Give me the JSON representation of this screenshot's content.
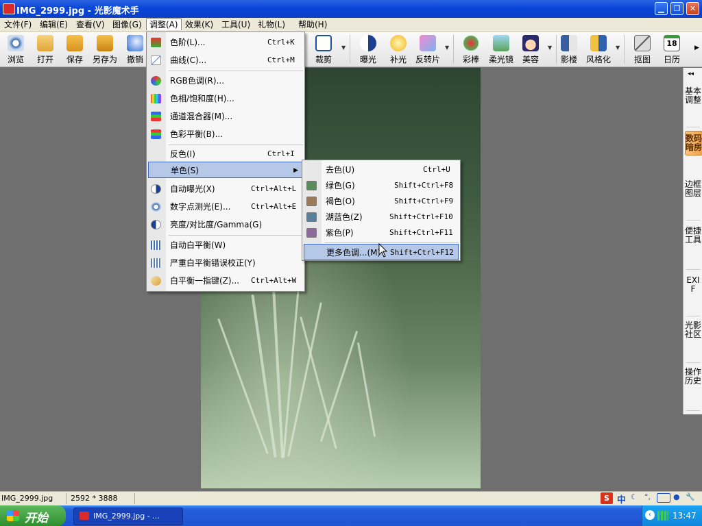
{
  "window": {
    "title": "IMG_2999.jpg - 光影魔术手",
    "minimize_icon": "minimize-icon",
    "maximize_icon": "restore-icon",
    "close_icon": "close-icon"
  },
  "menubar": {
    "items": [
      {
        "label": "文件(F)"
      },
      {
        "label": "编辑(E)"
      },
      {
        "label": "查看(V)"
      },
      {
        "label": "图像(G)"
      },
      {
        "label": "调整(A)"
      },
      {
        "label": "效果(K)"
      },
      {
        "label": "工具(U)"
      },
      {
        "label": "礼物(L)"
      },
      {
        "label": "帮助(H)"
      }
    ]
  },
  "toolbar": {
    "items": [
      {
        "label": "浏览"
      },
      {
        "label": "打开"
      },
      {
        "label": "保存"
      },
      {
        "label": "另存为"
      },
      {
        "label": "撤销"
      },
      {
        "label": "裁剪"
      },
      {
        "label": "曝光"
      },
      {
        "label": "补光"
      },
      {
        "label": "反转片"
      },
      {
        "label": "彩棒"
      },
      {
        "label": "柔光镜"
      },
      {
        "label": "美容"
      },
      {
        "label": "影楼"
      },
      {
        "label": "风格化"
      },
      {
        "label": "抠图"
      },
      {
        "label": "日历"
      }
    ],
    "calendar_day": "18"
  },
  "adjust_menu": {
    "items": [
      {
        "label": "色阶(L)...",
        "shortcut": "Ctrl+K"
      },
      {
        "label": "曲线(C)...",
        "shortcut": "Ctrl+M"
      },
      {
        "label": "RGB色调(R)...",
        "shortcut": ""
      },
      {
        "label": "色相/饱和度(H)...",
        "shortcut": ""
      },
      {
        "label": "通道混合器(M)...",
        "shortcut": ""
      },
      {
        "label": "色彩平衡(B)...",
        "shortcut": ""
      },
      {
        "label": "反色(I)",
        "shortcut": "Ctrl+I"
      },
      {
        "label": "单色(S)",
        "shortcut": ""
      },
      {
        "label": "自动曝光(X)",
        "shortcut": "Ctrl+Alt+L"
      },
      {
        "label": "数字点测光(E)...",
        "shortcut": "Ctrl+Alt+E"
      },
      {
        "label": "亮度/对比度/Gamma(G)",
        "shortcut": ""
      },
      {
        "label": "自动白平衡(W)",
        "shortcut": ""
      },
      {
        "label": "严重白平衡错误校正(Y)",
        "shortcut": ""
      },
      {
        "label": "白平衡一指键(Z)...",
        "shortcut": "Ctrl+Alt+W"
      }
    ]
  },
  "mono_submenu": {
    "items": [
      {
        "label": "去色(U)",
        "shortcut": "Ctrl+U"
      },
      {
        "label": "绿色(G)",
        "shortcut": "Shift+Ctrl+F8"
      },
      {
        "label": "褐色(O)",
        "shortcut": "Shift+Ctrl+F9"
      },
      {
        "label": "湖蓝色(Z)",
        "shortcut": "Shift+Ctrl+F10"
      },
      {
        "label": "紫色(P)",
        "shortcut": "Shift+Ctrl+F11"
      },
      {
        "label": "更多色调...(M)",
        "shortcut": "Shift+Ctrl+F12"
      }
    ]
  },
  "right_panel": {
    "tabs": [
      {
        "label": "基本调整"
      },
      {
        "label": "数码暗房"
      },
      {
        "label": "边框图层"
      },
      {
        "label": "便捷工具"
      },
      {
        "label": "EXIF"
      },
      {
        "label": "光影社区"
      },
      {
        "label": "操作历史"
      }
    ],
    "collapse_glyph": "◂◂"
  },
  "status": {
    "filename": "IMG_2999.jpg",
    "dimensions": "2592 * 3888"
  },
  "taskbar": {
    "start_label": "开始",
    "task_label": "IMG_2999.jpg - ...",
    "clock": "13:47",
    "ime_label": "中"
  },
  "colors": {
    "titlebar": "#0a46d8",
    "menu_highlight": "#b5c8e8",
    "active_tab": "#f2a24a",
    "photo_tint": "#536d4f"
  }
}
